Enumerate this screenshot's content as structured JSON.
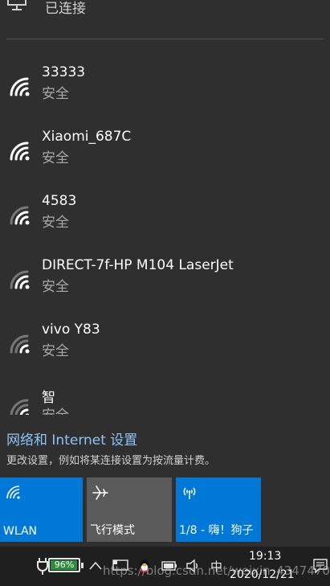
{
  "header": {
    "status_text": "已连接",
    "icon": "monitor-icon"
  },
  "networks": [
    {
      "name": "33333",
      "security": "安全"
    },
    {
      "name": "Xiaomi_687C",
      "security": "安全"
    },
    {
      "name": "4583",
      "security": "安全"
    },
    {
      "name": "DIRECT-7f-HP M104 LaserJet",
      "security": "安全"
    },
    {
      "name": "vivo Y83",
      "security": "安全"
    },
    {
      "name": "智",
      "security": "安全"
    }
  ],
  "settings": {
    "link_text": "网络和 Internet 设置",
    "description": "更改设置，例如将某连接设置为按流量计费。"
  },
  "tiles": [
    {
      "label": "WLAN",
      "icon": "wifi-icon",
      "color": "#0078d7"
    },
    {
      "label": "飞行模式",
      "icon": "airplane-icon",
      "color": "#5a5a5a"
    },
    {
      "label": "1/8 - 嗨！狗子",
      "icon": "hotspot-icon",
      "color": "#0078d7"
    }
  ],
  "taskbar": {
    "battery_percent": "96%",
    "battery_level": 0.96,
    "ime": "中",
    "time": "19:13",
    "date": "2020/12/21",
    "watermark": "https://blog.csdn.net/weixin_4347470"
  },
  "colors": {
    "panel_bg": "#2f2f2f",
    "accent": "#0078d7",
    "link": "#8cc3f5",
    "taskbar_bg": "#1f1f1f"
  }
}
